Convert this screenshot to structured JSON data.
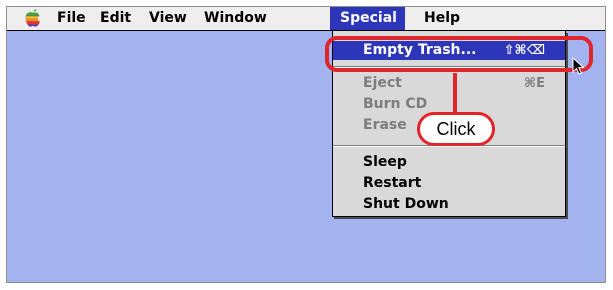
{
  "menubar": {
    "menus": [
      {
        "label": "File"
      },
      {
        "label": "Edit"
      },
      {
        "label": "View"
      },
      {
        "label": "Window"
      },
      {
        "label": "Special"
      },
      {
        "label": "Help"
      }
    ]
  },
  "special_menu": {
    "items": [
      {
        "label": "Empty Trash...",
        "shortcut": "⇧⌘⌫",
        "state": "selected"
      },
      {
        "label": "Eject",
        "shortcut": "⌘E",
        "state": "disabled"
      },
      {
        "label": "Burn CD",
        "shortcut": "",
        "state": "disabled"
      },
      {
        "label": "Erase",
        "shortcut": "",
        "state": "disabled"
      },
      {
        "label": "Sleep",
        "shortcut": "",
        "state": "enabled"
      },
      {
        "label": "Restart",
        "shortcut": "",
        "state": "enabled"
      },
      {
        "label": "Shut Down",
        "shortcut": "",
        "state": "enabled"
      }
    ]
  },
  "annotation": {
    "callout_text": "Click"
  },
  "colors": {
    "desktop": "#a3b3f0",
    "selection": "#2d36b9",
    "callout": "#e0252b",
    "menu_background": "#d9d9d9"
  },
  "icons": {
    "apple": "apple-logo-icon",
    "cursor": "arrow-cursor-icon"
  }
}
